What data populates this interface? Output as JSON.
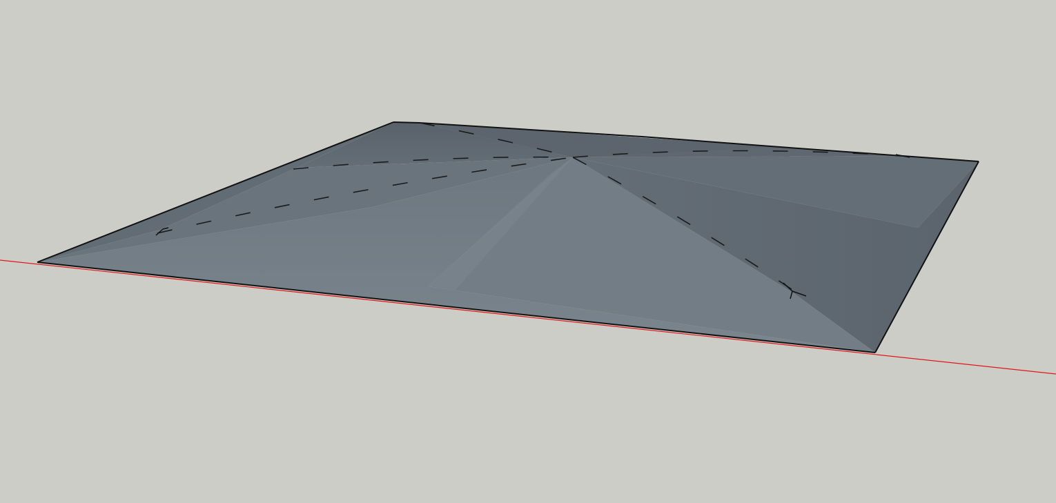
{
  "viewport": {
    "background_color": "#cdcdc8"
  },
  "model": {
    "name": "",
    "surface_colors": {
      "face_light": "#76818a",
      "face_mid": "#6b757e",
      "face_dark": "#5d666e",
      "edge": "#111111"
    }
  },
  "axes": {
    "x_axis_color": "#e01515"
  }
}
